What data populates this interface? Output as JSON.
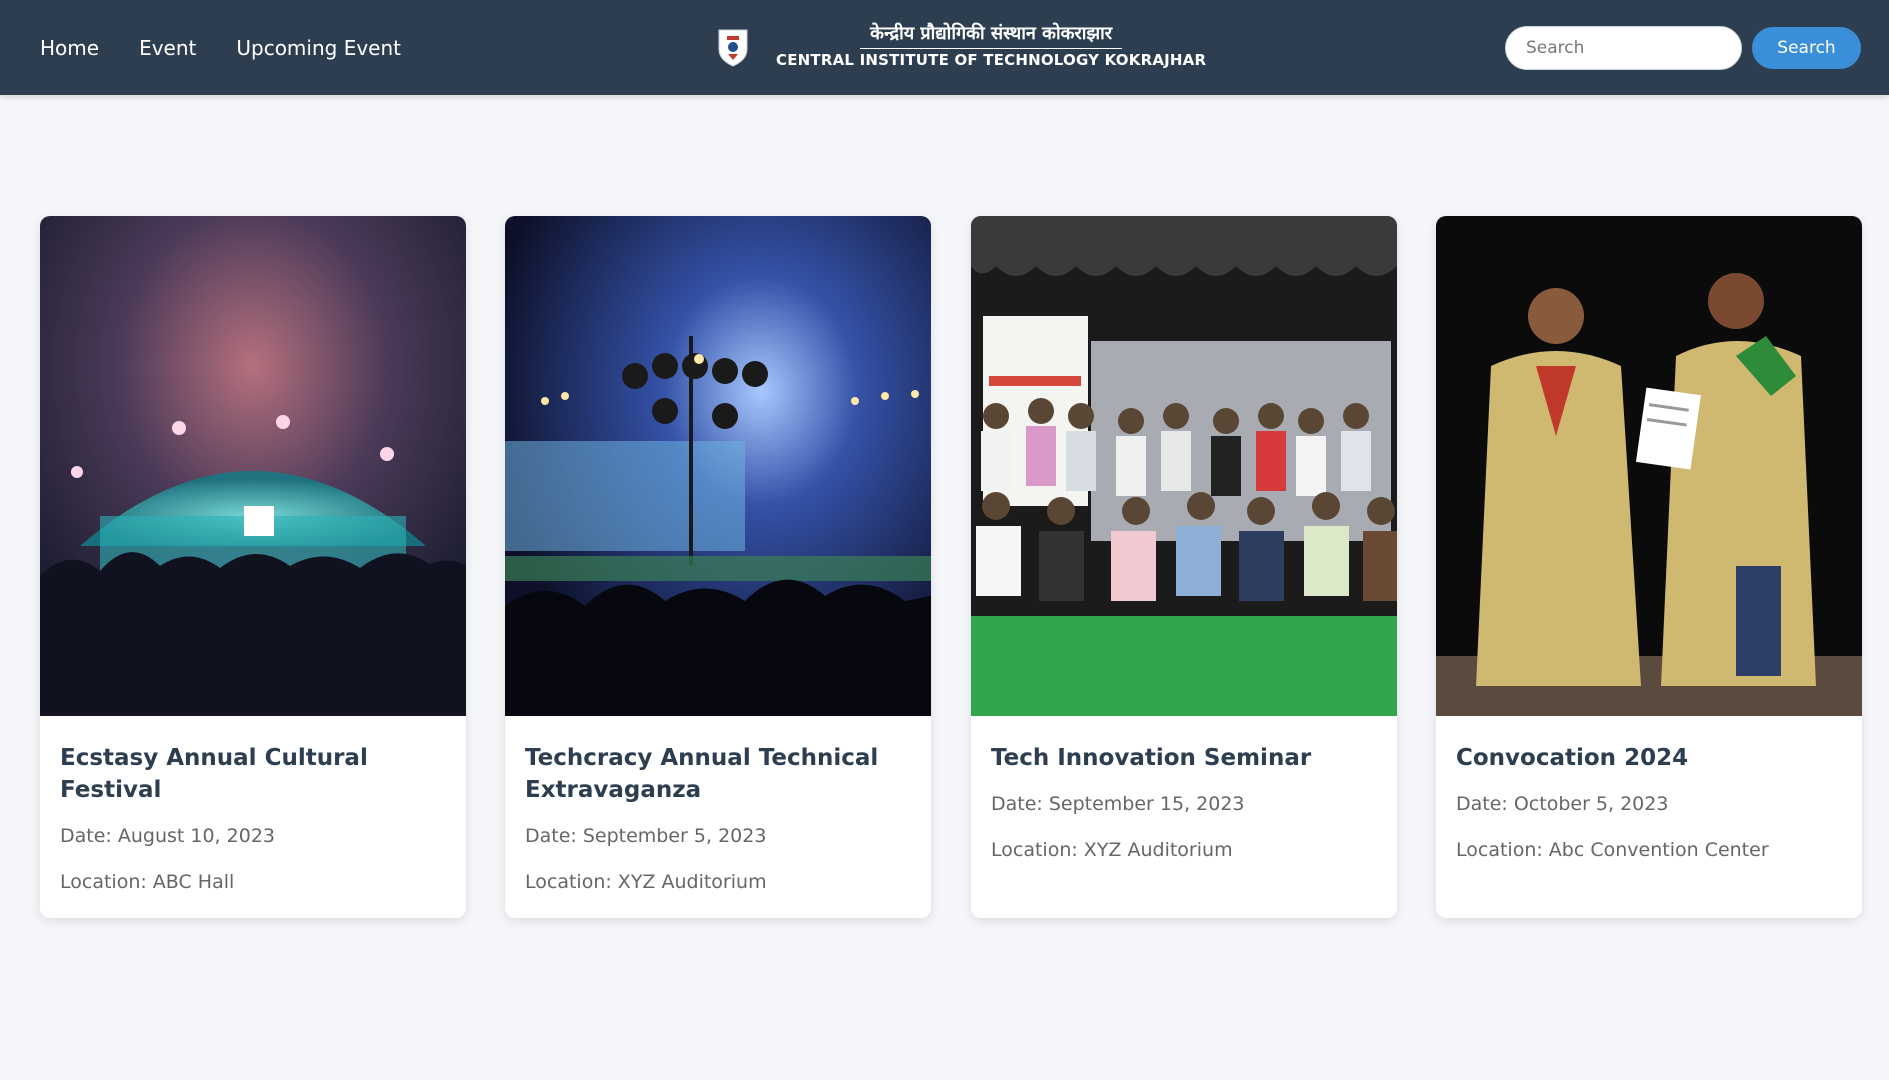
{
  "nav": {
    "links": [
      "Home",
      "Event",
      "Upcoming Event"
    ],
    "brand_hindi": "केन्द्रीय प्रौद्योगिकी संस्थान कोकराझार",
    "brand_english": "CENTRAL INSTITUTE OF TECHNOLOGY KOKRAJHAR",
    "search_placeholder": "Search",
    "search_button": "Search"
  },
  "colors": {
    "navbar": "#2c3e50",
    "accent": "#3a8fd8",
    "page_background": "#f4f6f9"
  },
  "events": [
    {
      "title": "Ecstasy Annual Cultural Festival",
      "date": "Date: August 10, 2023",
      "location": "Location: ABC Hall"
    },
    {
      "title": "Techcracy Annual Technical Extravaganza",
      "date": "Date: September 5, 2023",
      "location": "Location: XYZ Auditorium"
    },
    {
      "title": "Tech Innovation Seminar",
      "date": "Date: September 15, 2023",
      "location": "Location: XYZ Auditorium"
    },
    {
      "title": "Convocation 2024",
      "date": "Date: October 5, 2023",
      "location": "Location: Abc Convention Center"
    }
  ]
}
